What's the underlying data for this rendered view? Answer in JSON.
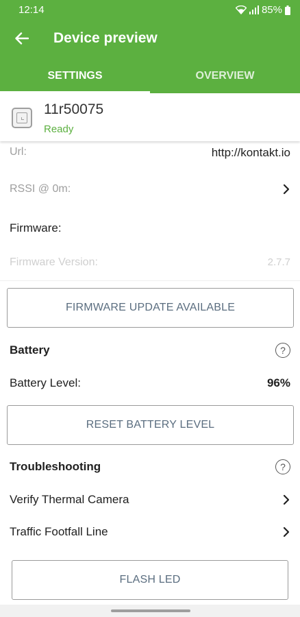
{
  "status_bar": {
    "time": "12:14",
    "battery": "85%"
  },
  "toolbar": {
    "title": "Device preview"
  },
  "tabs": [
    {
      "label": "SETTINGS",
      "active": true
    },
    {
      "label": "OVERVIEW",
      "active": false
    }
  ],
  "device": {
    "name": "11r50075",
    "status": "Ready"
  },
  "rows": {
    "url": {
      "label": "Url:",
      "value": "http://kontakt.io"
    },
    "rssi": {
      "label": "RSSI @ 0m:"
    },
    "firmware": {
      "label": "Firmware:"
    },
    "firmware_version": {
      "label": "Firmware Version:",
      "value": "2.7.7"
    }
  },
  "buttons": {
    "firmware_update": "FIRMWARE UPDATE AVAILABLE",
    "reset_battery": "RESET BATTERY LEVEL",
    "flash_led": "FLASH LED"
  },
  "battery": {
    "heading": "Battery",
    "level_label": "Battery Level:",
    "level_value": "96%",
    "help": "?"
  },
  "troubleshooting": {
    "heading": "Troubleshooting",
    "help": "?",
    "items": [
      {
        "label": "Verify Thermal Camera"
      },
      {
        "label": "Traffic Footfall Line"
      }
    ]
  },
  "colors": {
    "primary": "#5cb040",
    "ready": "#5cb040",
    "button_text": "#5a6d7f"
  }
}
